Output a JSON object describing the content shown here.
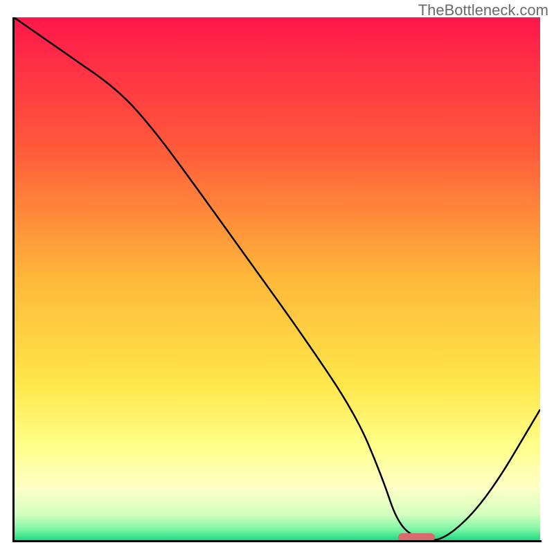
{
  "watermark": "TheBottleneck.com",
  "chart_data": {
    "type": "line",
    "title": "",
    "xlabel": "",
    "ylabel": "",
    "xlim": [
      0,
      100
    ],
    "ylim": [
      0,
      100
    ],
    "x": [
      0,
      10,
      20,
      27,
      35,
      45,
      55,
      65,
      70,
      73,
      77,
      82,
      90,
      100
    ],
    "values": [
      100,
      93,
      86,
      78,
      67,
      53,
      39,
      24,
      12,
      3,
      0,
      0,
      8,
      25
    ],
    "marker": {
      "x_start": 73,
      "x_end": 80,
      "y": 0
    },
    "gradient_stops": [
      {
        "offset": 0,
        "color": "#ff174b"
      },
      {
        "offset": 25,
        "color": "#ff5a3a"
      },
      {
        "offset": 50,
        "color": "#ffb83a"
      },
      {
        "offset": 70,
        "color": "#ffe64a"
      },
      {
        "offset": 82,
        "color": "#ffff8a"
      },
      {
        "offset": 90,
        "color": "#fdffc5"
      },
      {
        "offset": 95,
        "color": "#d5ffbf"
      },
      {
        "offset": 98,
        "color": "#7cf5a5"
      },
      {
        "offset": 100,
        "color": "#1cd980"
      }
    ]
  }
}
